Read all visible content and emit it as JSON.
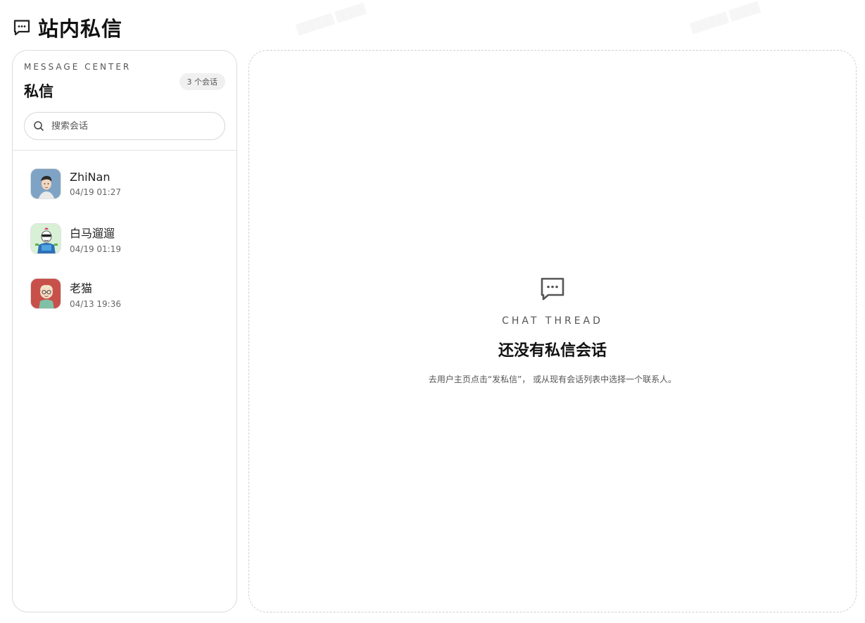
{
  "header": {
    "title": "站内私信",
    "icon": "chat-bubble-icon"
  },
  "sidebar": {
    "eyebrow": "MESSAGE CENTER",
    "title": "私信",
    "count_badge": "3 个会话",
    "search": {
      "placeholder": "搜索会话",
      "value": "",
      "icon": "search-icon"
    },
    "conversations": [
      {
        "name": "ZhiNan",
        "time": "04/19 01:27",
        "avatar_color": "#7fa3c4"
      },
      {
        "name": "白马遛遛",
        "time": "04/19 01:19",
        "avatar_color": "#d8f0d6"
      },
      {
        "name": "老猫",
        "time": "04/13 19:36",
        "avatar_color": "#c8504a"
      }
    ]
  },
  "main": {
    "empty_state": {
      "icon": "chat-bubble-icon",
      "eyebrow": "CHAT THREAD",
      "title": "还没有私信会话",
      "description": "去用户主页点击“发私信”， 或从现有会话列表中选择一个联系人。"
    }
  }
}
